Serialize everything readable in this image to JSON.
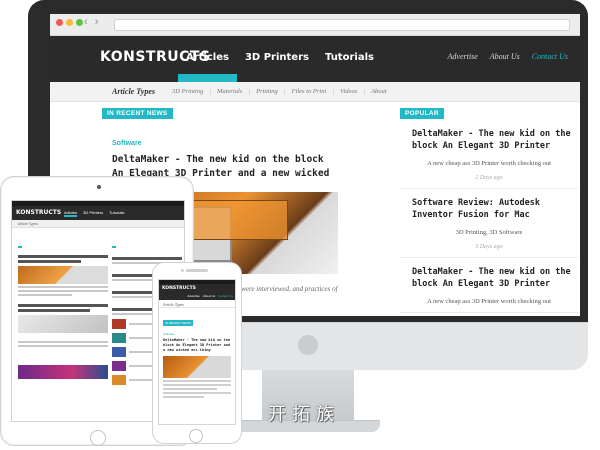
{
  "desktop": {
    "logo": "KONSTRUCTS",
    "nav": [
      "Articles",
      "3D Printers",
      "Tutorials"
    ],
    "right_nav": [
      "Advertise",
      "About Us",
      "Contact Us"
    ],
    "subnav_title": "Article Types",
    "subnav_links": [
      "3D Printing",
      "Materials",
      "Printing",
      "Files to Print",
      "Videos",
      "About"
    ],
    "recent_label": "IN RECENT NEWS",
    "recent_category": "Software",
    "recent_headline": "DeltaMaker - The new kid on the block An Elegant 3D Printer and a new wicked ass thing",
    "recent_excerpt": "n of especially productive teams in and teams were interviewed, and practices of creative leaders.",
    "popular_label": "POPULAR",
    "popular": [
      {
        "title": "DeltaMaker - The new kid on the block An Elegant 3D Printer",
        "caption": "A new cheap ass 3D Printer worth checking out",
        "date": "2 Days ago"
      },
      {
        "title": "Software Review: Autodesk Inventor Fusion for Mac",
        "caption": "3D Printing, 3D Software",
        "date": "5 Days ago"
      },
      {
        "title": "DeltaMaker - The new kid on the block An Elegant 3D Printer",
        "caption": "A new cheap ass 3D Printer worth checking out",
        "date": ""
      }
    ]
  },
  "tablet": {
    "logo": "KONSTRUCTS",
    "nav": [
      "Articles",
      "3D Printers",
      "Tutorials"
    ],
    "subnav": "Article Types"
  },
  "phone": {
    "logo": "KONSTRUCTS",
    "nav": [
      "Advertise",
      "About Us",
      "Contact Us"
    ],
    "subnav": "Article Types",
    "tag": "IN RECENT NEWS",
    "category": "Software",
    "headline": "DeltaMaker - The new kid on the block An Elegant 3D Printer and a new wicked ass thing"
  },
  "watermark": "开拓族",
  "colors": {
    "accent": "#22b8c4",
    "header_bg": "#2a2a2a",
    "device_frame": "#2b2b2b"
  }
}
